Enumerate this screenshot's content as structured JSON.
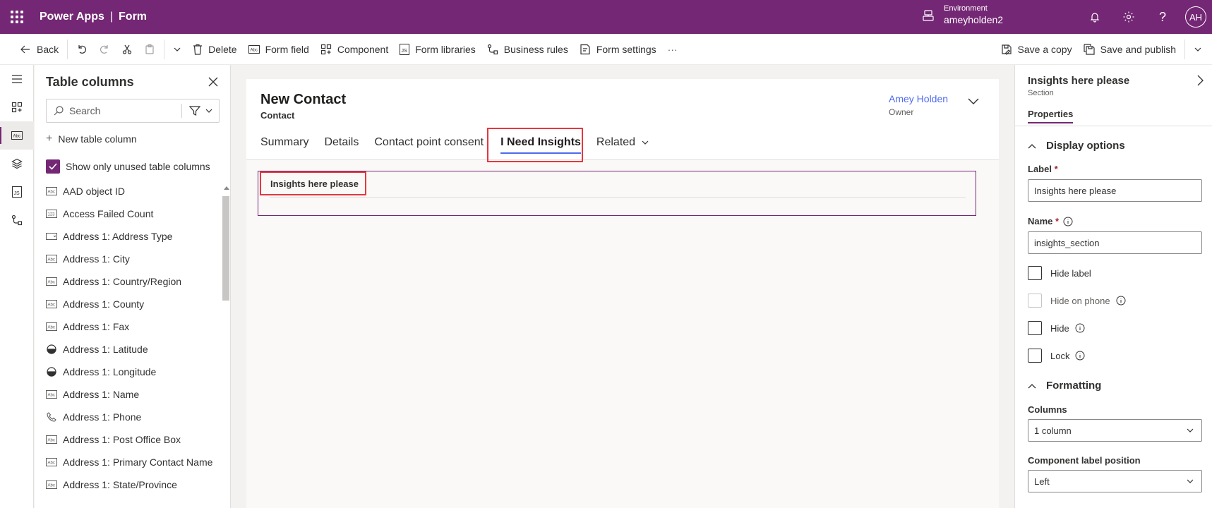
{
  "header": {
    "app_name": "Power Apps",
    "separator": "|",
    "page_name": "Form",
    "environment_label": "Environment",
    "environment_name": "ameyholden2",
    "user_initials": "AH"
  },
  "toolbar": {
    "back_label": "Back",
    "delete_label": "Delete",
    "form_field_label": "Form field",
    "component_label": "Component",
    "form_libraries_label": "Form libraries",
    "business_rules_label": "Business rules",
    "form_settings_label": "Form settings",
    "more_label": "···",
    "save_copy_label": "Save a copy",
    "save_publish_label": "Save and publish"
  },
  "table_columns": {
    "title": "Table columns",
    "search_placeholder": "Search",
    "new_column_label": "New table column",
    "show_unused_label": "Show only unused table columns",
    "items": [
      {
        "label": "AAD object ID",
        "type_icon": "text-field-icon"
      },
      {
        "label": "Access Failed Count",
        "type_icon": "number-field-icon"
      },
      {
        "label": "Address 1: Address Type",
        "type_icon": "choice-field-icon"
      },
      {
        "label": "Address 1: City",
        "type_icon": "text-field-icon"
      },
      {
        "label": "Address 1: Country/Region",
        "type_icon": "text-field-icon"
      },
      {
        "label": "Address 1: County",
        "type_icon": "text-field-icon"
      },
      {
        "label": "Address 1: Fax",
        "type_icon": "text-field-icon"
      },
      {
        "label": "Address 1: Latitude",
        "type_icon": "decimal-field-icon"
      },
      {
        "label": "Address 1: Longitude",
        "type_icon": "decimal-field-icon"
      },
      {
        "label": "Address 1: Name",
        "type_icon": "text-field-icon"
      },
      {
        "label": "Address 1: Phone",
        "type_icon": "phone-field-icon"
      },
      {
        "label": "Address 1: Post Office Box",
        "type_icon": "text-field-icon"
      },
      {
        "label": "Address 1: Primary Contact Name",
        "type_icon": "text-field-icon"
      },
      {
        "label": "Address 1: State/Province",
        "type_icon": "text-field-icon"
      }
    ]
  },
  "form": {
    "record_title": "New Contact",
    "entity_name": "Contact",
    "owner_name": "Amey Holden",
    "owner_label": "Owner",
    "tabs": [
      {
        "label": "Summary"
      },
      {
        "label": "Details"
      },
      {
        "label": "Contact point consent"
      },
      {
        "label": "I Need Insights"
      },
      {
        "label": "Related"
      }
    ],
    "section_label": "Insights here please"
  },
  "properties": {
    "title": "Insights here please",
    "subtitle": "Section",
    "tab_label": "Properties",
    "display_options_label": "Display options",
    "label_field_label": "Label",
    "label_value": "Insights here please",
    "required_marker": "*",
    "name_field_label": "Name",
    "name_value": "insights_section",
    "hide_label_label": "Hide label",
    "hide_on_phone_label": "Hide on phone",
    "hide_label": "Hide",
    "lock_label": "Lock",
    "formatting_label": "Formatting",
    "columns_label": "Columns",
    "columns_value": "1 column",
    "component_label_position_label": "Component label position",
    "component_label_position_value": "Left"
  },
  "colors": {
    "brand": "#742774",
    "tab_underline": "#4f6bed",
    "highlight": "#e2383f"
  }
}
